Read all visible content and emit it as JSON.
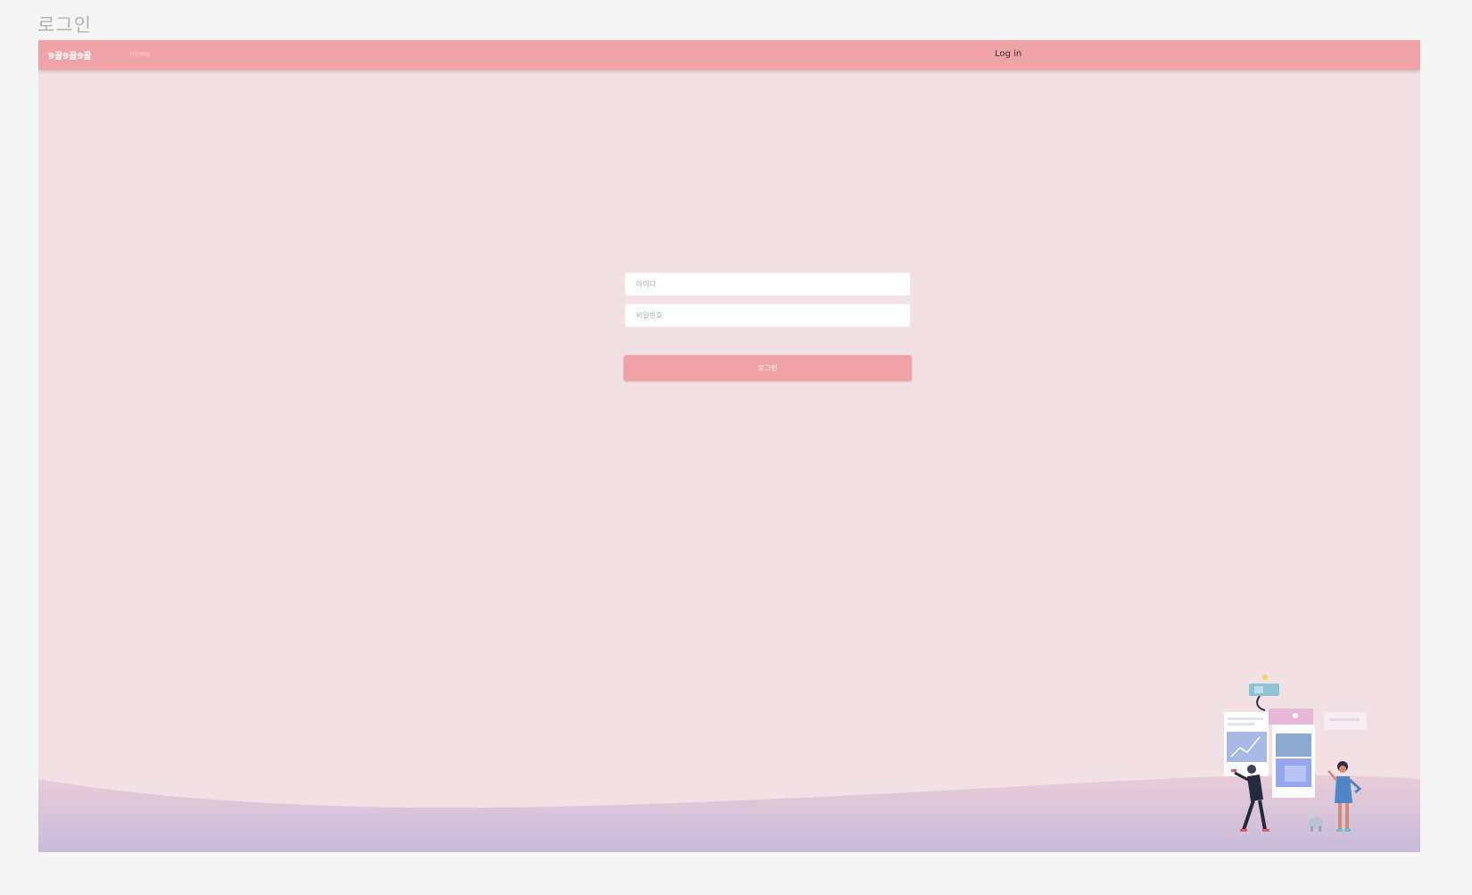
{
  "page": {
    "heading": "로그인"
  },
  "navbar": {
    "brand": "9끌9끌9끌",
    "home": "Home",
    "login": "Log in"
  },
  "form": {
    "id_placeholder": "아이디",
    "password_placeholder": "비밀번호",
    "submit_label": "로그인"
  },
  "colors": {
    "accent": "#f0a3a7",
    "frame_background": "#f1e1e4",
    "page_background": "#f5f5f5",
    "wave_bottom": "#c9bcdc"
  }
}
